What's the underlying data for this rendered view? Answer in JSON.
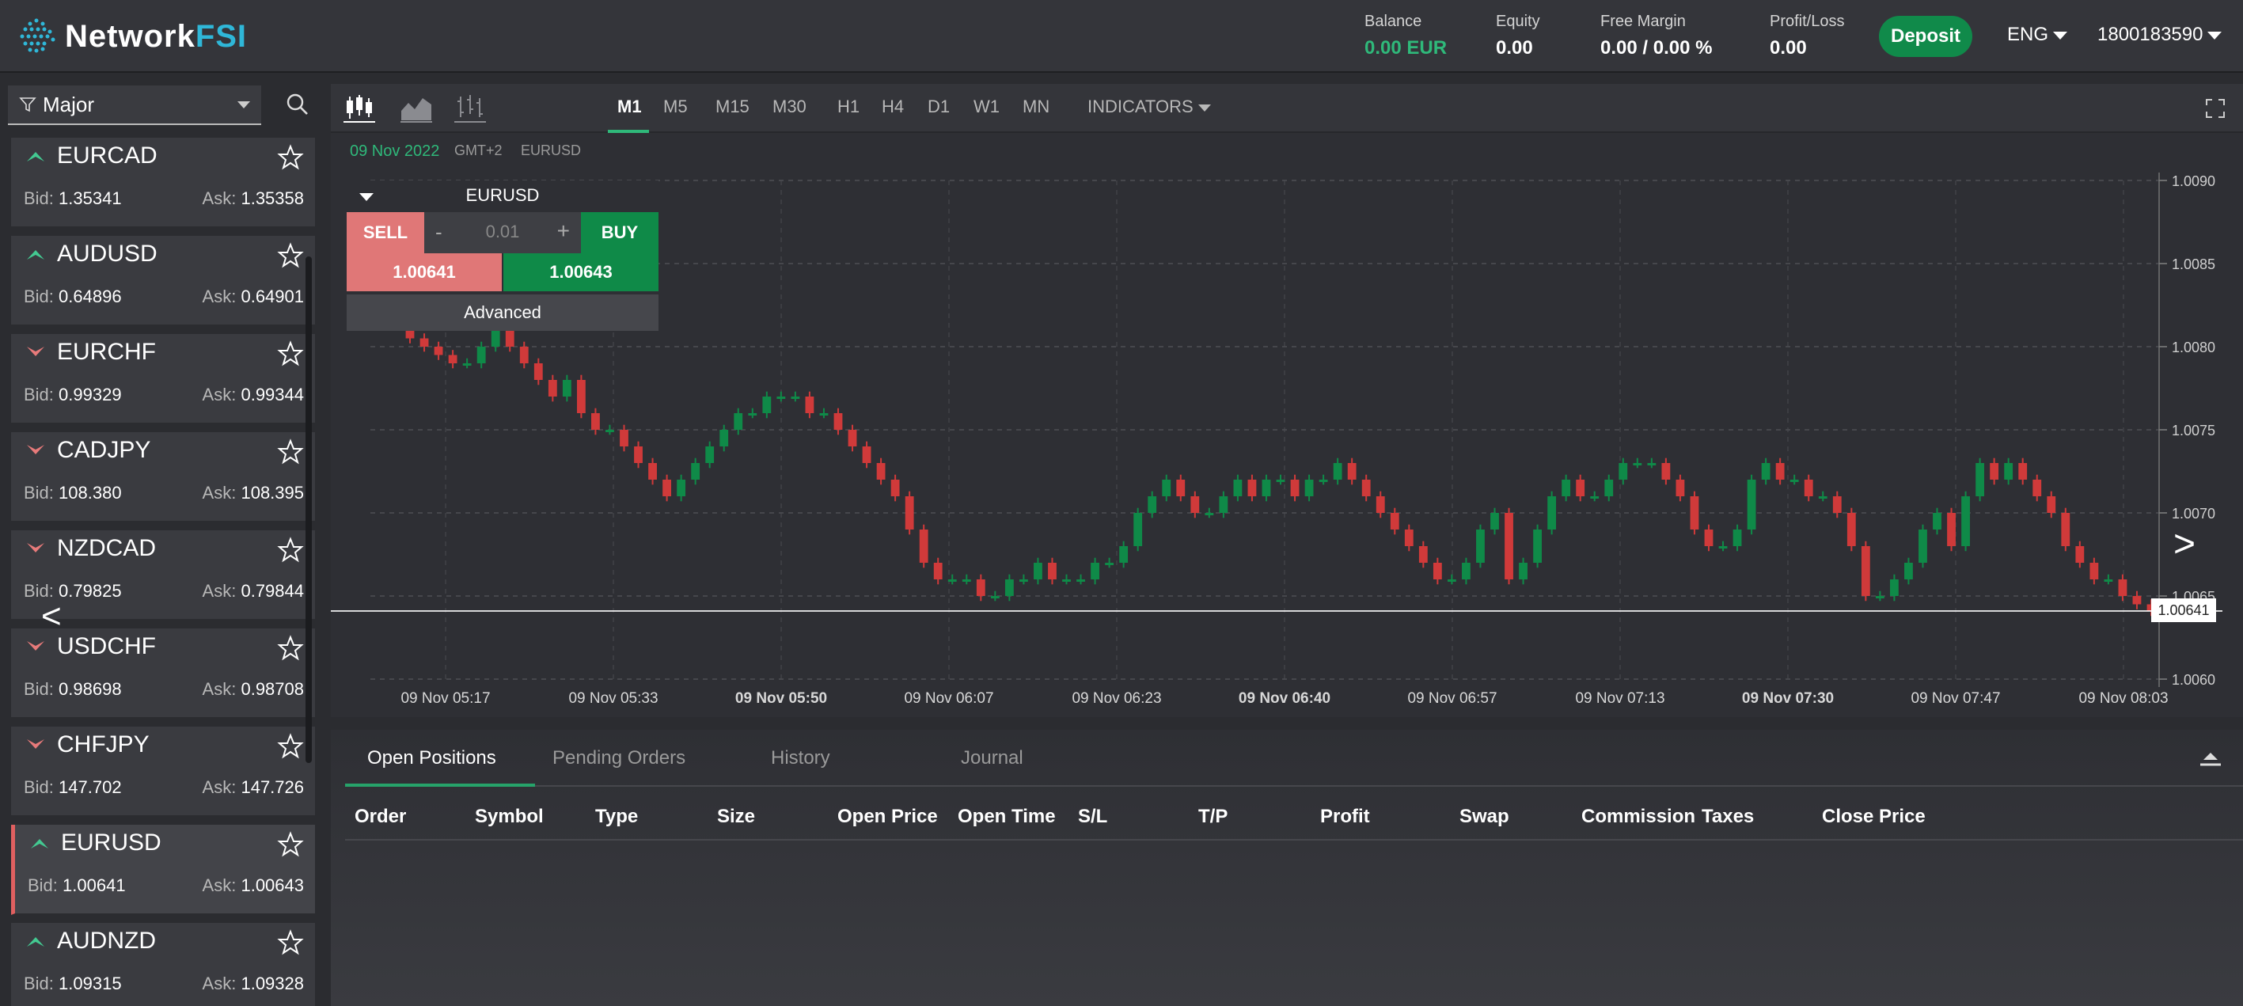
{
  "brand": {
    "name_main": "Network",
    "name_accent": "FSI"
  },
  "account": {
    "balance_label": "Balance",
    "balance_value": "0.00 EUR",
    "equity_label": "Equity",
    "equity_value": "0.00",
    "free_margin_label": "Free Margin",
    "free_margin_value": "0.00 / 0.00 %",
    "pl_label": "Profit/Loss",
    "pl_value": "0.00",
    "deposit_label": "Deposit",
    "language": "ENG",
    "account_number": "1800183590"
  },
  "sidebar": {
    "filter_value": "Major",
    "bid_key": "Bid:",
    "ask_key": "Ask:",
    "symbols": [
      {
        "name": "EURCAD",
        "dir": "up",
        "bid": "1.35341",
        "ask": "1.35358"
      },
      {
        "name": "AUDUSD",
        "dir": "up",
        "bid": "0.64896",
        "ask": "0.64901"
      },
      {
        "name": "EURCHF",
        "dir": "down",
        "bid": "0.99329",
        "ask": "0.99344"
      },
      {
        "name": "CADJPY",
        "dir": "down",
        "bid": "108.380",
        "ask": "108.395"
      },
      {
        "name": "NZDCAD",
        "dir": "down",
        "bid": "0.79825",
        "ask": "0.79844"
      },
      {
        "name": "USDCHF",
        "dir": "down",
        "bid": "0.98698",
        "ask": "0.98708"
      },
      {
        "name": "CHFJPY",
        "dir": "down",
        "bid": "147.702",
        "ask": "147.726"
      },
      {
        "name": "EURUSD",
        "dir": "up",
        "bid": "1.00641",
        "ask": "1.00643",
        "active": true
      },
      {
        "name": "AUDNZD",
        "dir": "up",
        "bid": "1.09315",
        "ask": "1.09328"
      }
    ]
  },
  "chart": {
    "timeframes": [
      "M1",
      "M5",
      "M15",
      "M30",
      "H1",
      "H4",
      "D1",
      "W1",
      "MN"
    ],
    "active_timeframe": "M1",
    "indicators_label": "INDICATORS",
    "date": "09 Nov 2022",
    "timezone": "GMT+2",
    "symbol": "EURUSD",
    "current_price_label": "1.00641"
  },
  "trade_box": {
    "pair": "EURUSD",
    "sell_label": "SELL",
    "buy_label": "BUY",
    "minus": "-",
    "plus": "+",
    "quantity": "0.01",
    "sell_price": "1.00641",
    "buy_price": "1.00643",
    "advanced_label": "Advanced"
  },
  "chart_data": {
    "type": "candlestick",
    "symbol": "EURUSD",
    "y_ticks": [
      "1.0090",
      "1.0085",
      "1.0080",
      "1.0075",
      "1.0070",
      "1.0065",
      "1.0060"
    ],
    "ylim": [
      1.006,
      1.009
    ],
    "x_ticks": [
      "09 Nov 05:17",
      "09 Nov 05:33",
      "09 Nov 05:50",
      "09 Nov 06:07",
      "09 Nov 06:23",
      "09 Nov 06:40",
      "09 Nov 06:57",
      "09 Nov 07:13",
      "09 Nov 07:30",
      "09 Nov 07:47",
      "09 Nov 08:03"
    ],
    "x_ticks_bold": [
      false,
      false,
      true,
      false,
      false,
      true,
      false,
      false,
      true,
      false,
      false
    ],
    "current_price": 1.00641,
    "closes": [
      1.00805,
      1.008,
      1.00795,
      1.0079,
      1.0079,
      1.008,
      1.0081,
      1.008,
      1.0079,
      1.0078,
      1.0077,
      1.0078,
      1.0076,
      1.0075,
      1.0075,
      1.0074,
      1.0073,
      1.0072,
      1.0071,
      1.0072,
      1.0073,
      1.0074,
      1.0075,
      1.0076,
      1.0076,
      1.0077,
      1.0077,
      1.0077,
      1.0076,
      1.0076,
      1.0075,
      1.0074,
      1.0073,
      1.0072,
      1.0071,
      1.0069,
      1.0067,
      1.0066,
      1.0066,
      1.0066,
      1.0065,
      1.0065,
      1.0066,
      1.0066,
      1.0067,
      1.0066,
      1.0066,
      1.0066,
      1.0067,
      1.0067,
      1.0068,
      1.007,
      1.0071,
      1.0072,
      1.0071,
      1.007,
      1.007,
      1.0071,
      1.0072,
      1.0071,
      1.0072,
      1.0072,
      1.0071,
      1.0072,
      1.0072,
      1.0073,
      1.0072,
      1.0071,
      1.007,
      1.0069,
      1.0068,
      1.0067,
      1.0066,
      1.0066,
      1.0067,
      1.0069,
      1.007,
      1.0066,
      1.0067,
      1.0069,
      1.0071,
      1.0072,
      1.0071,
      1.0071,
      1.0072,
      1.0073,
      1.0073,
      1.0073,
      1.0072,
      1.0071,
      1.0069,
      1.0068,
      1.0068,
      1.0069,
      1.0072,
      1.0073,
      1.0072,
      1.0072,
      1.0071,
      1.0071,
      1.007,
      1.0068,
      1.0065,
      1.0065,
      1.0066,
      1.0067,
      1.0069,
      1.007,
      1.0068,
      1.0071,
      1.0073,
      1.0072,
      1.0073,
      1.0072,
      1.0071,
      1.007,
      1.0068,
      1.0067,
      1.0066,
      1.0066,
      1.0065,
      1.00645,
      1.00641
    ]
  },
  "bottom": {
    "tabs": [
      "Open Positions",
      "Pending Orders",
      "History",
      "Journal"
    ],
    "columns": [
      "Order",
      "Symbol",
      "Type",
      "Size",
      "Open Price",
      "Open Time",
      "S/L",
      "T/P",
      "Profit",
      "Swap",
      "Commission",
      "Taxes",
      "Close Price"
    ]
  },
  "colors": {
    "up": "#0f8a48",
    "down": "#d03a3a",
    "accent_green": "#2fb97a",
    "accent_blue": "#2fb7d8"
  }
}
